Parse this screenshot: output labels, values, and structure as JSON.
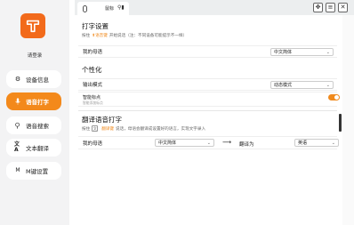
{
  "sidebar": {
    "login_label": "请登录",
    "items": [
      {
        "label": "设备信息",
        "icon": "settings-icon"
      },
      {
        "label": "语音打字",
        "icon": "microphone-icon"
      },
      {
        "label": "语音搜索",
        "icon": "search-icon"
      },
      {
        "label": "文本翻译",
        "icon": "translate-icon"
      },
      {
        "label": "M键设置",
        "icon": "m-key-icon"
      }
    ],
    "active_index": 1
  },
  "topbar": {
    "tab_label": "鼠标",
    "window_buttons": [
      "✥",
      "≡",
      "✕"
    ]
  },
  "typing_settings": {
    "title": "打字设置",
    "hint_prefix": "按住",
    "hint_key": "语音键",
    "hint_suffix": "开始说话（注：不同设备可能提示不一样）",
    "language_label": "我的母语",
    "language_value": "中文简体"
  },
  "personalization": {
    "title": "个性化",
    "output_mode_label": "输出模式",
    "output_mode_value": "动态模式",
    "smart_label": "智能标点",
    "smart_sublabel": "智能添加标点",
    "smart_enabled": true
  },
  "translation": {
    "title": "翻译语音打字",
    "hint_prefix": "按住",
    "hint_key": "翻译键",
    "hint_suffix": "说话，母语会翻译成设置好的语言，实现文字录入",
    "source_label": "我的母语",
    "source_value": "中文简体",
    "target_label": "翻译为",
    "target_value": "英语"
  },
  "colors": {
    "accent": "#f3891b",
    "logo": "#f26a1b"
  }
}
